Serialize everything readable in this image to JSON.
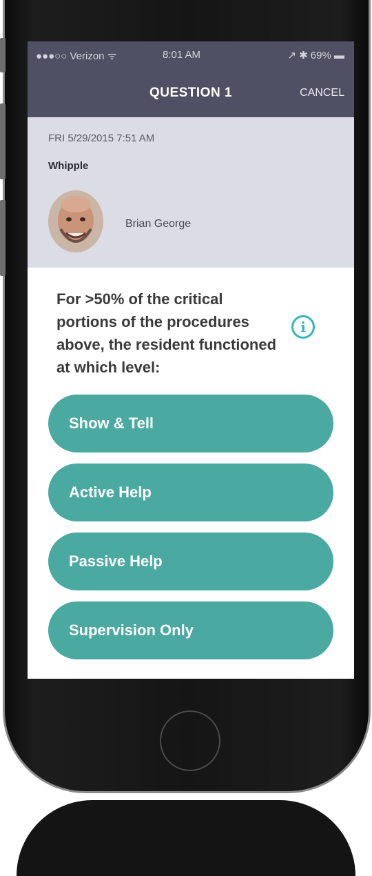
{
  "status_bar": {
    "carrier": "●●●○○ Verizon ᯤ",
    "time": "8:01 AM",
    "battery": "↗ ✱ 69% ▬"
  },
  "nav": {
    "title": "QUESTION 1",
    "cancel_label": "CANCEL"
  },
  "case": {
    "date": "FRI 5/29/2015  7:51 AM",
    "procedure": "Whipple",
    "person_name": "Brian George"
  },
  "question": {
    "text": "For >50% of the critical portions of the procedures above, the resident functioned at which level:",
    "info_icon": "info-icon"
  },
  "options": [
    {
      "label": "Show & Tell"
    },
    {
      "label": "Active Help"
    },
    {
      "label": "Passive Help"
    },
    {
      "label": "Supervision Only"
    }
  ],
  "colors": {
    "header": "#4f5063",
    "panel": "#dcdce5",
    "option": "#4aaaa2",
    "accent": "#30b9b3"
  }
}
